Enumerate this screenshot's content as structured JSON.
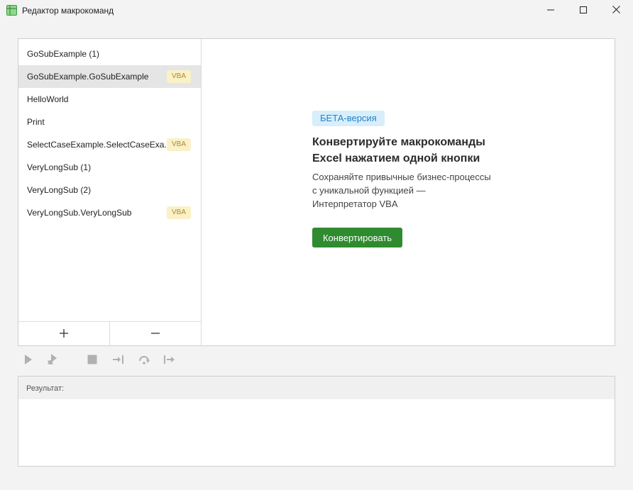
{
  "window": {
    "title": "Редактор макрокоманд",
    "icon": "spreadsheet-app-icon",
    "controls": [
      "minimize-icon",
      "maximize-icon",
      "close-icon"
    ]
  },
  "macros": {
    "items": [
      {
        "label": "GoSubExample (1)",
        "badge": "",
        "selected": false
      },
      {
        "label": "GoSubExample.GoSubExample",
        "badge": "VBA",
        "selected": true
      },
      {
        "label": "HelloWorld",
        "badge": "",
        "selected": false
      },
      {
        "label": "Print",
        "badge": "",
        "selected": false
      },
      {
        "label": "SelectCaseExample.SelectCaseExa...",
        "badge": "VBA",
        "selected": false
      },
      {
        "label": "VeryLongSub (1)",
        "badge": "",
        "selected": false
      },
      {
        "label": "VeryLongSub (2)",
        "badge": "",
        "selected": false
      },
      {
        "label": "VeryLongSub.VeryLongSub",
        "badge": "VBA",
        "selected": false
      }
    ],
    "add_icon": "plus-icon",
    "remove_icon": "minus-icon"
  },
  "promo": {
    "badge": "БЕТА-версия",
    "title_line1": "Конвертируйте макрокоманды",
    "title_line2": "Excel нажатием одной кнопки",
    "text_line1": "Сохраняйте привычные бизнес-процессы",
    "text_line2": "с уникальной функцией —",
    "text_line3": "Интерпретатор VBA",
    "button": "Конвертировать"
  },
  "toolbar": {
    "tools": [
      "run-icon",
      "debug-icon",
      "stop-icon",
      "step-into-icon",
      "step-over-icon",
      "step-out-icon"
    ]
  },
  "result": {
    "label": "Результат:",
    "output": ""
  },
  "colors": {
    "accent_green": "#2f8b2f",
    "beta_bg": "#d9eefb",
    "beta_text": "#1f86c8",
    "vba_bg": "#fbf1c7",
    "vba_text": "#a9893a",
    "selected_row": "#e5e5e5"
  }
}
